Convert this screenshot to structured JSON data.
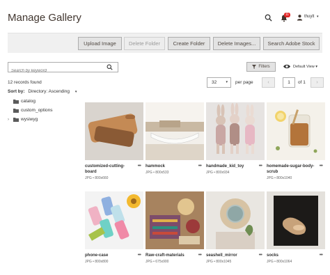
{
  "header": {
    "title": "Manage Gallery",
    "notification_count": "11",
    "user_name": "thuylt"
  },
  "toolbar": {
    "buttons": [
      {
        "label": "Upload Image",
        "disabled": false
      },
      {
        "label": "Delete Folder",
        "disabled": true
      },
      {
        "label": "Create Folder",
        "disabled": false
      },
      {
        "label": "Delete Images...",
        "disabled": false
      },
      {
        "label": "Search Adobe Stock",
        "disabled": false
      }
    ]
  },
  "search": {
    "placeholder": "Search by keyword",
    "value": ""
  },
  "filters_label": "Filters",
  "view_label": "Default View",
  "records_text": "12 records found",
  "pager": {
    "size": "32",
    "per_page_label": "per page",
    "current": "1",
    "of_label": "of 1"
  },
  "sort": {
    "label": "Sort by:",
    "value": "Directory: Ascending"
  },
  "tree": [
    {
      "label": "catalog",
      "expandable": false
    },
    {
      "label": "custom_options",
      "expandable": false
    },
    {
      "label": "wysiwyg",
      "expandable": true
    }
  ],
  "images": [
    {
      "name": "customized-cutting-board",
      "meta": "JPG • 800x660"
    },
    {
      "name": "hammock",
      "meta": "JPG • 800x533"
    },
    {
      "name": "handmade_kid_toy",
      "meta": "JPG • 800x934"
    },
    {
      "name": "homemade-sugar-body-scrub",
      "meta": "JPG • 800x1040"
    },
    {
      "name": "phone-case",
      "meta": "JPG • 800x800"
    },
    {
      "name": "Raw-craft-materials",
      "meta": "JPG • 675x900"
    },
    {
      "name": "seashell_mirror",
      "meta": "JPG • 800x1045"
    },
    {
      "name": "socks",
      "meta": "JPG • 800x1064"
    }
  ],
  "colors": {
    "accent": "#e22626",
    "toolbar_bg": "#f0f0f0"
  }
}
